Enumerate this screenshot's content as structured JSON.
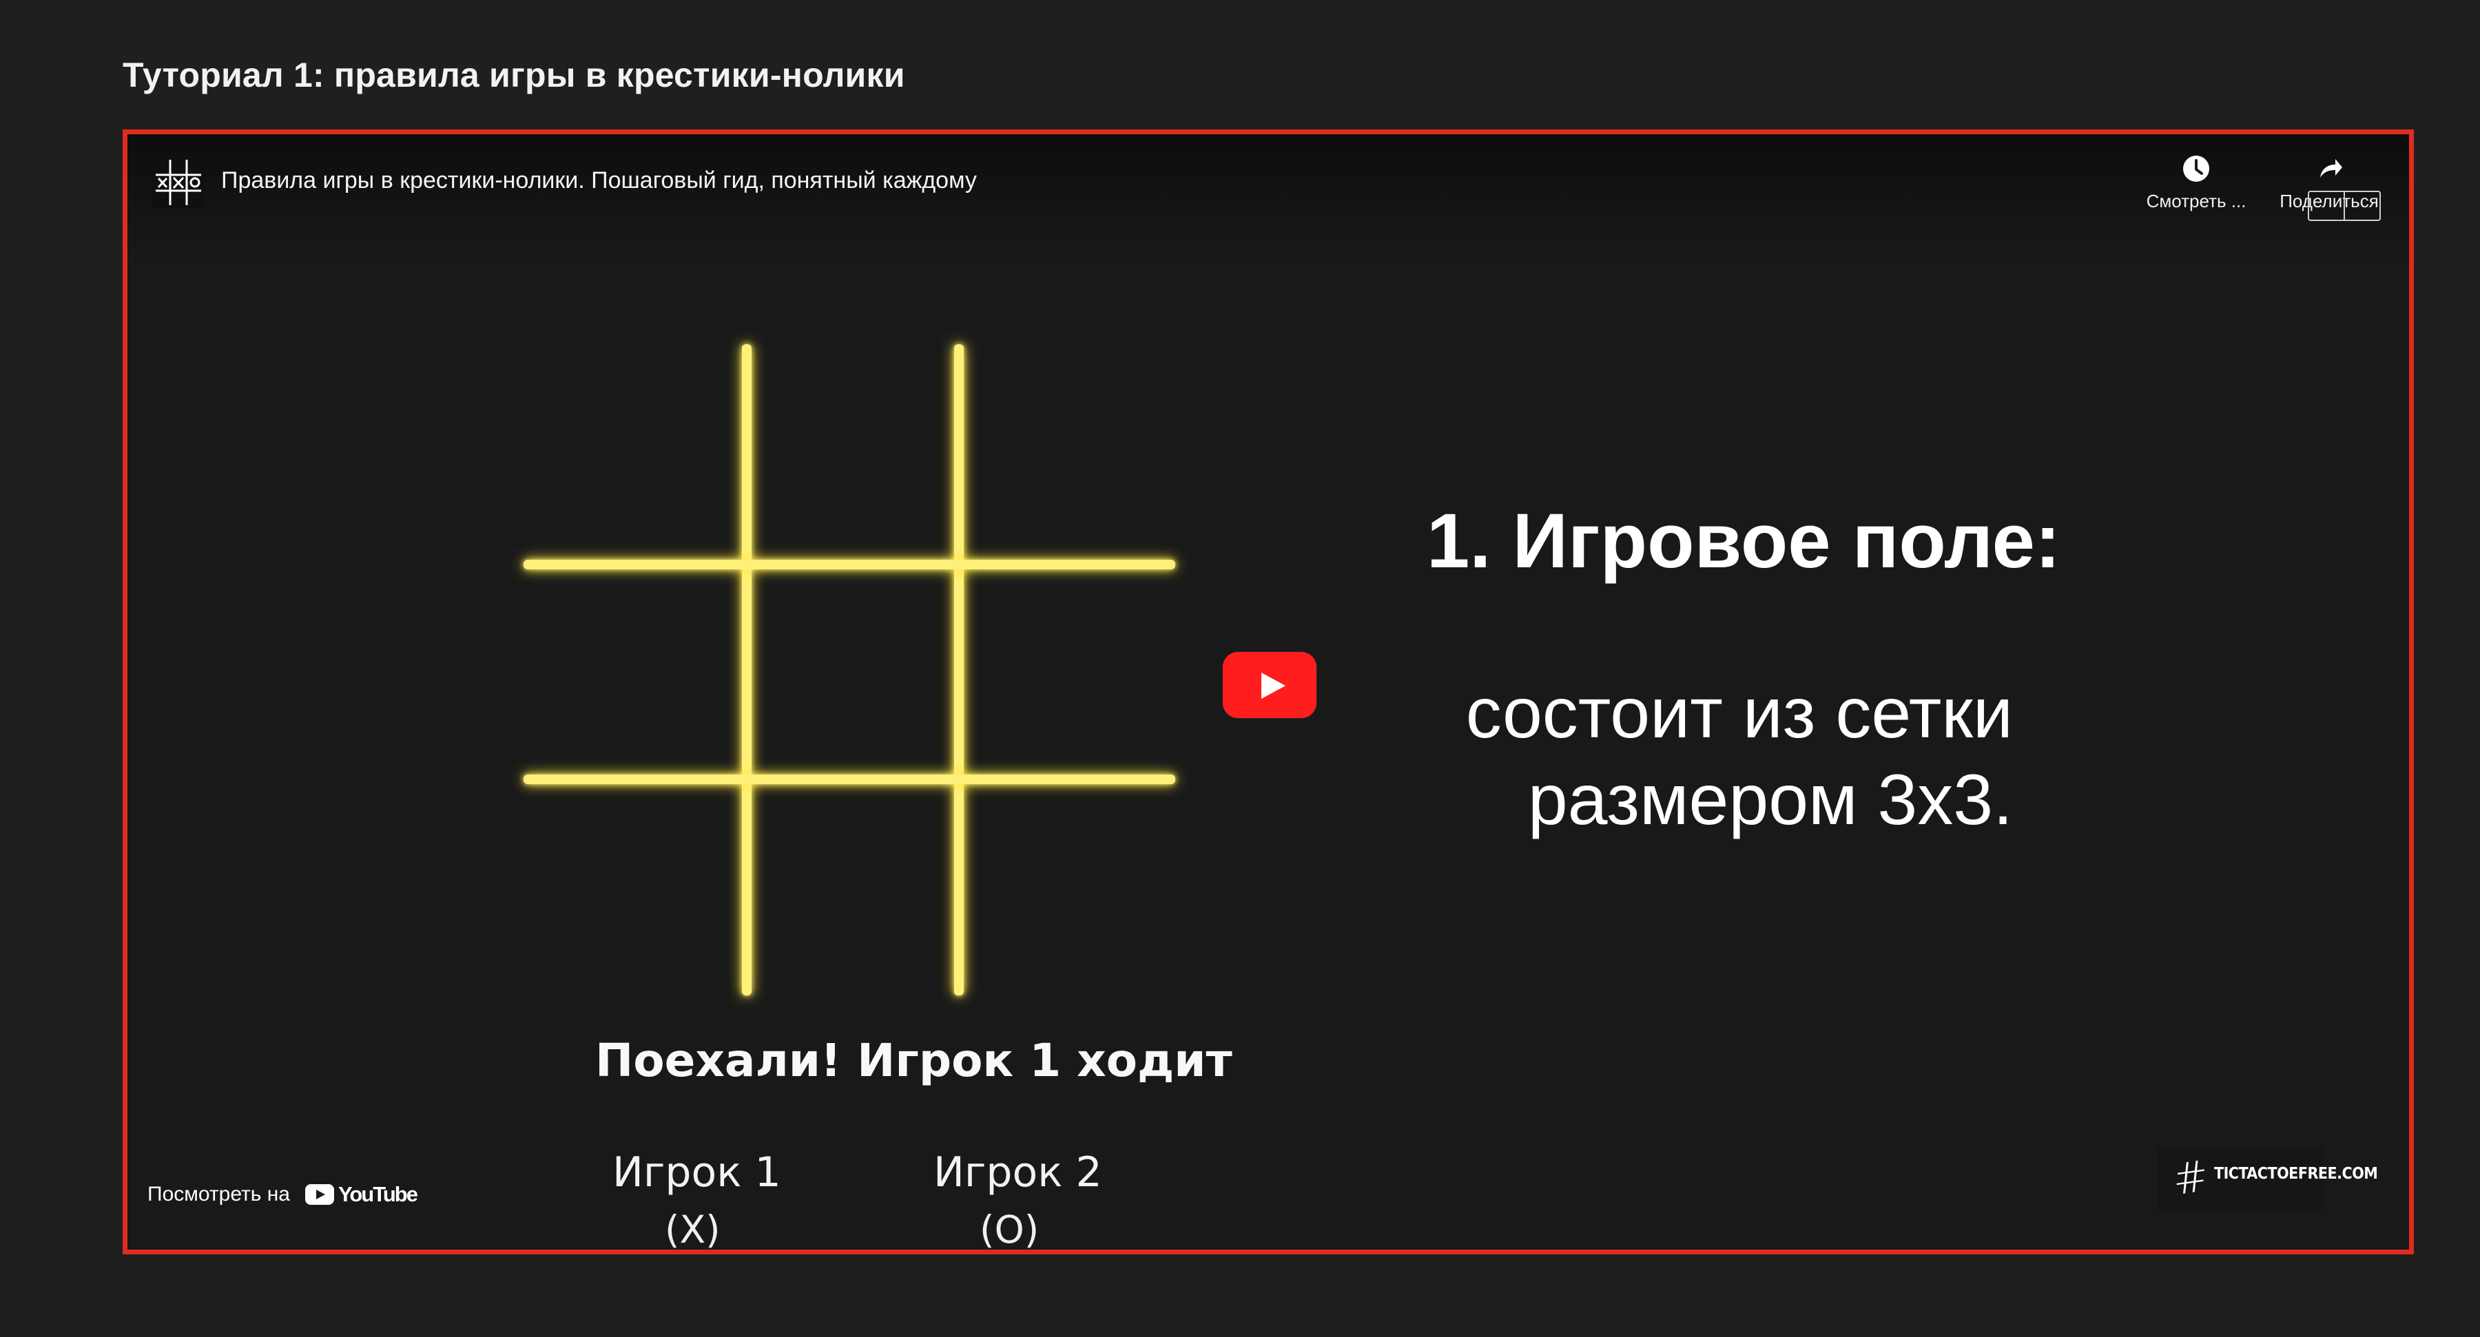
{
  "page": {
    "section_title": "Туториал 1: правила игры в крестики-нолики"
  },
  "video": {
    "channel_icon": "tic-tac-toe-logo-icon",
    "title": "Правила игры в крестики-нолики. Пошаговый гид, понятный каждому",
    "watch_later_label": "Смотреть ...",
    "watch_later_icon": "clock-icon",
    "share_label": "Поделиться",
    "share_icon": "share-arrow-icon",
    "play_icon": "youtube-play-icon",
    "watch_on_label": "Посмотреть на",
    "youtube_label": "YouTube",
    "site_watermark": "TICTACTOEFREE.COM"
  },
  "slide": {
    "heading": "1. Игровое поле:",
    "body_line_1": "состоит из сетки",
    "body_line_2": "размером 3х3.",
    "caption": "Поехали! Игрок 1 ходит",
    "player_1_label": "Игрок 1",
    "player_2_label": "Игрок 2",
    "player_1_symbol": "(X)",
    "player_2_symbol": "(O)"
  },
  "colors": {
    "page_background": "#1f1f1f",
    "video_background": "#191919",
    "focus_outline": "#e02b20",
    "grid_lines": "#fff07a",
    "play_button": "#ff1d1d",
    "text": "#ffffff"
  }
}
